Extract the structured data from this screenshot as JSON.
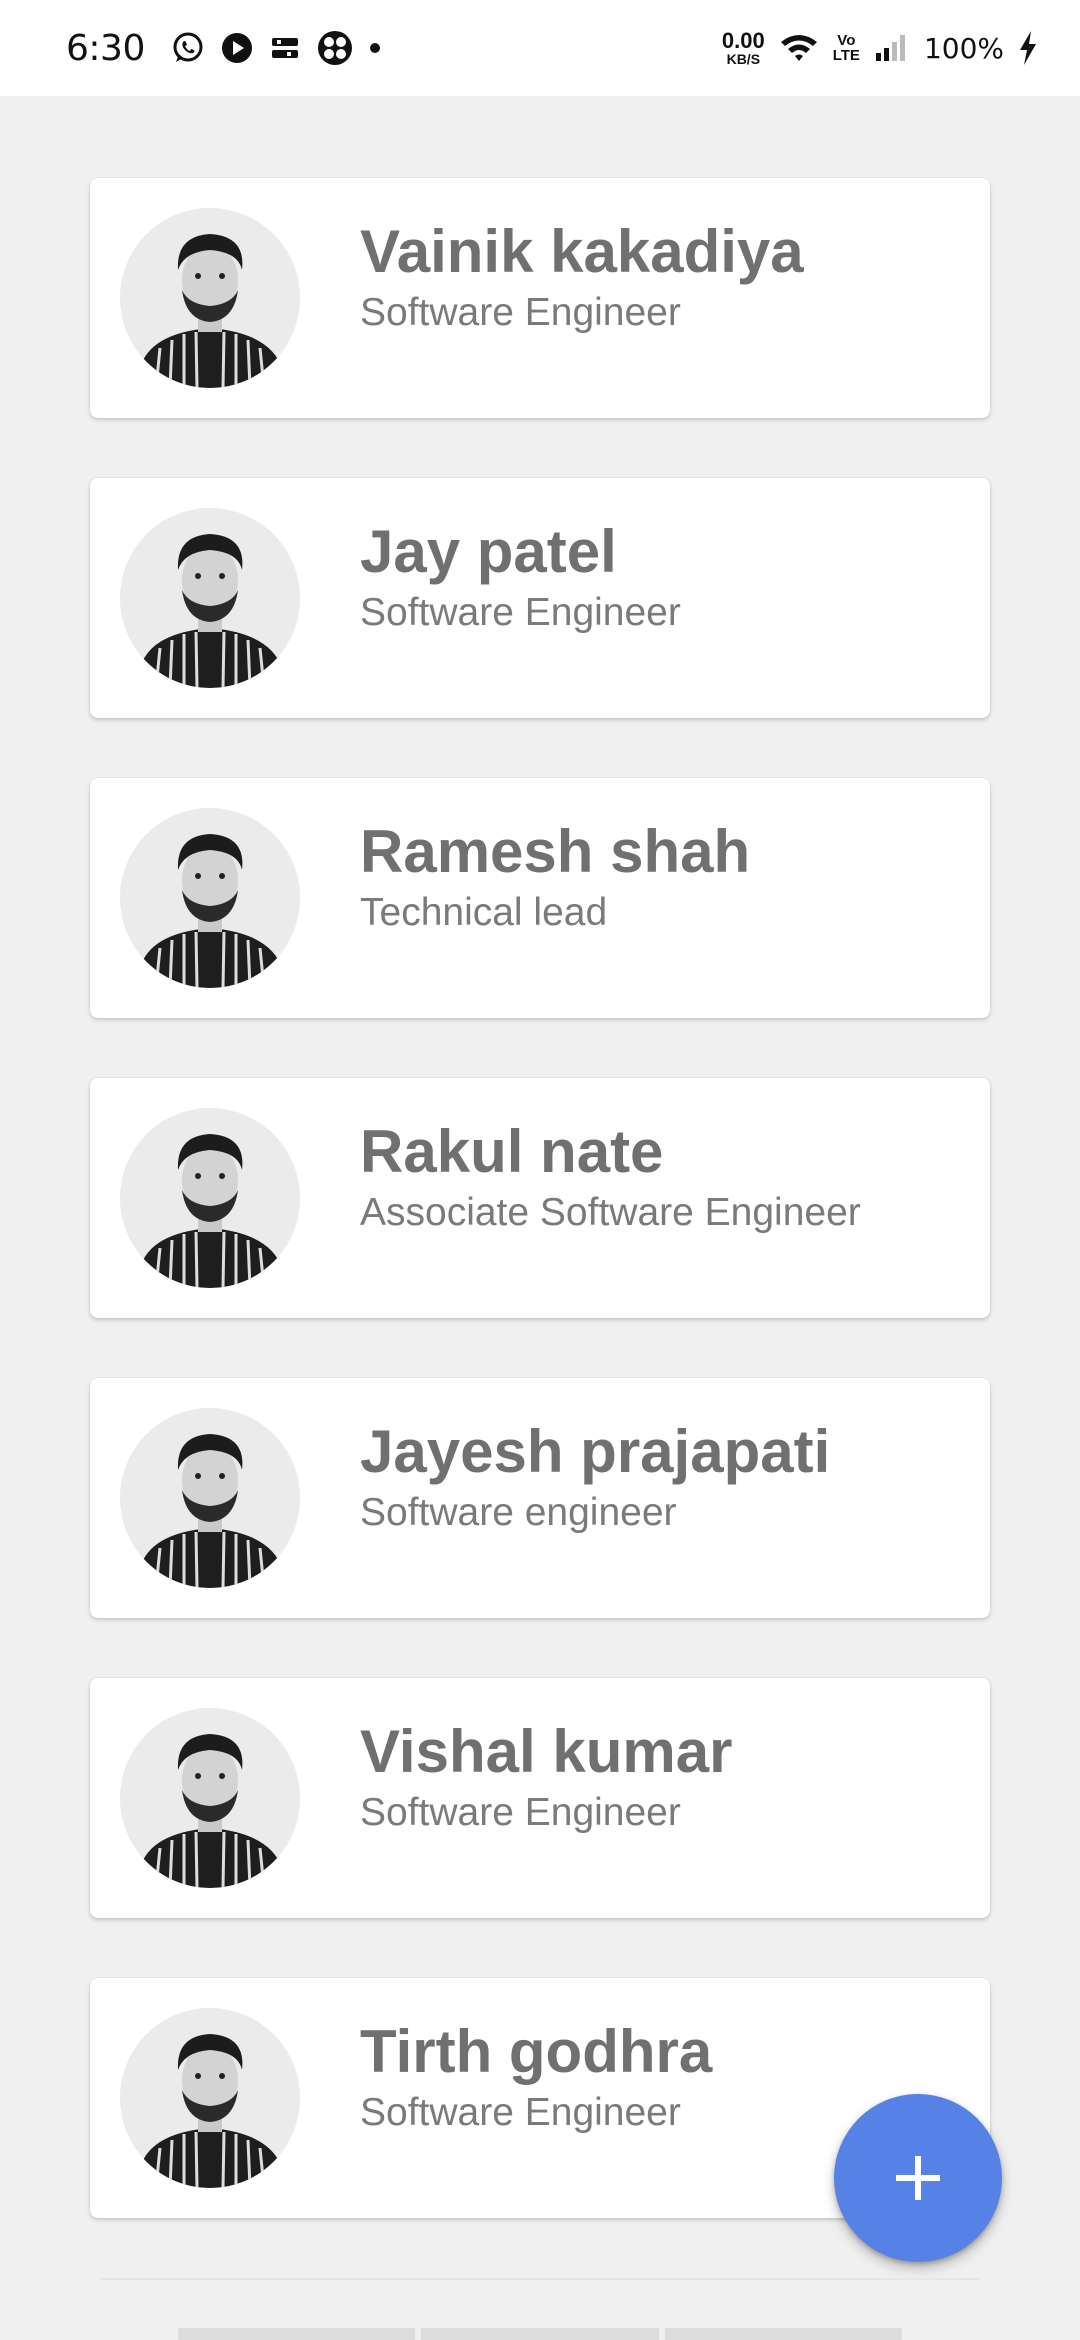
{
  "status_bar": {
    "time": "6:30",
    "net_speed_value": "0.00",
    "net_speed_unit": "KB/S",
    "volte_top": "Vo",
    "volte_bottom": "LTE",
    "battery": "100%",
    "icons": [
      "whatsapp-icon",
      "play-icon",
      "app-icon",
      "fan-icon",
      "dot-icon",
      "wifi-icon",
      "signal-icon",
      "charging-icon"
    ]
  },
  "contacts": [
    {
      "name": "Vainik kakadiya",
      "role": "Software Engineer"
    },
    {
      "name": "Jay patel",
      "role": "Software Engineer"
    },
    {
      "name": "Ramesh shah",
      "role": "Technical lead"
    },
    {
      "name": "Rakul nate",
      "role": "Associate Software Engineer"
    },
    {
      "name": "Jayesh prajapati",
      "role": "Software engineer"
    },
    {
      "name": "Vishal kumar",
      "role": "Software Engineer"
    },
    {
      "name": "Tirth godhra",
      "role": "Software Engineer"
    }
  ],
  "fab": {
    "icon": "plus-icon",
    "color": "#5682e6"
  },
  "colors": {
    "background": "#f0f0f0",
    "card": "#ffffff",
    "name_text": "#707070",
    "role_text": "#7a7a7a"
  }
}
